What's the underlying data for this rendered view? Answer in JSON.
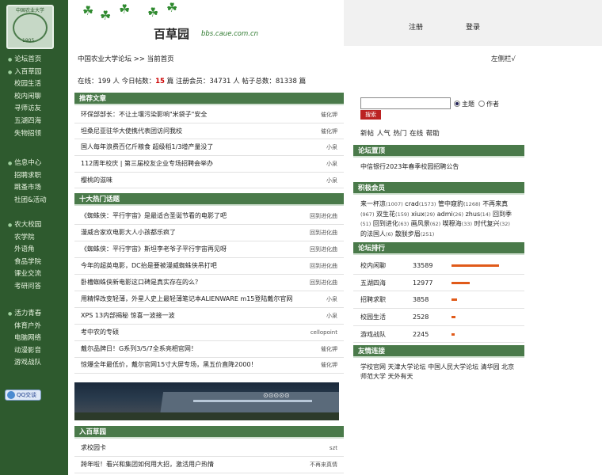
{
  "sidebar": {
    "logo": {
      "top_text": "中国农业大学",
      "year": "1905"
    },
    "sections": [
      {
        "items": [
          "论坛首页",
          "入百草园",
          "校园生活",
          "校内闲聊",
          "寻师访友",
          "五湖四海",
          "失物招领"
        ]
      },
      {
        "items": [
          "信息中心",
          "招聘求职",
          "跳蚤市场",
          "社团&活动"
        ]
      },
      {
        "items": [
          "农大校园",
          "农学院",
          "外语角",
          "食品学院",
          "课业交流",
          "考研问答"
        ]
      },
      {
        "items": [
          "活力青春",
          "体育户外",
          "电脑网络",
          "动漫影音",
          "游戏战队"
        ]
      }
    ],
    "qq_label": "QQ交谈"
  },
  "header": {
    "site_name": "百草园",
    "site_url": "bbs.caue.com.cn",
    "register": "注册",
    "login": "登录"
  },
  "breadcrumb": "中国农业大学论坛 >> 当前首页",
  "left_toggle": "左侧栏√",
  "stats": {
    "p1": "在线：199 人 今日帖数：",
    "today": "15",
    "p2": " 篇 注册会员：34731 人 帖子总数：81338 篇"
  },
  "recommend": {
    "title": "推荐文章",
    "rows": [
      {
        "t": "环保部部长：不让土壤污染影响\"米袋子\"安全",
        "a": "催化钾"
      },
      {
        "t": "坦桑尼亚驻华大使携代表团访问我校",
        "a": "催化钾"
      },
      {
        "t": "国人每年浪费百亿斤粮食 超级稻1/3增产量没了",
        "a": "小泉"
      },
      {
        "t": "112周年校庆 | 第三届校友企业专场招聘会举办",
        "a": "小泉"
      },
      {
        "t": "樱桃的滋味",
        "a": "小泉"
      }
    ]
  },
  "hot": {
    "title": "十大热门话题",
    "rows": [
      {
        "t": "《蜘蛛侠：平行宇宙》是最适合圣诞节看的电影了吧",
        "a": "回到进化曲"
      },
      {
        "t": "漫威合家欢电影大人小孩都乐疯了",
        "a": "回到进化曲"
      },
      {
        "t": "《蜘蛛侠：平行宇宙》斯坦李老爷子平行宇宙再见呀",
        "a": "回到进化曲"
      },
      {
        "t": "今年的超英电影，DC抬是要被漫威蜘蛛侠吊打吧",
        "a": "回到进化曲"
      },
      {
        "t": "卧槽蜘蛛侠新电影这口碑是真实存在的么？",
        "a": "回到进化曲"
      },
      {
        "t": "用精悍改变轻薄，外星人史上最轻薄笔记本ALIENWARE m15登陆戴尔官网",
        "a": "小泉"
      },
      {
        "t": "XPS 13内部揭秘 惊喜一波接一波",
        "a": "小泉"
      },
      {
        "t": "考中农的专硕",
        "a": "cellopoint"
      },
      {
        "t": "戴尔品牌日！G系列3/5/7全系亮相官网！",
        "a": "催化钾"
      },
      {
        "t": "惊爆全年最低价，戴尔官网15寸大屏专场，黑五价直降2000！",
        "a": "催化钾"
      }
    ]
  },
  "banner_image": {
    "text": "⊙⊙⊙⊙⊙"
  },
  "enter": {
    "title": "入百草园",
    "rows": [
      {
        "t": "求校园卡",
        "a": "szt"
      },
      {
        "t": "跨年啦！看兴和集团如何用大招，激活用户热情",
        "a": "不再来真情"
      }
    ]
  },
  "search": {
    "button": "搜索",
    "opt1": "主题",
    "opt2": "作者"
  },
  "quick_links": "新帖 人气 热门 在线 帮助",
  "pinned": {
    "title": "论坛置顶",
    "text": "中信银行2023年春季校园招聘公告"
  },
  "members": {
    "title": "积极会员",
    "list": [
      {
        "n": "来一杯凉",
        "c": "(1007)"
      },
      {
        "n": "crad",
        "c": "(1573)"
      },
      {
        "n": "管中窥豹",
        "c": "(1268)"
      },
      {
        "n": "不再来真",
        "c": "(967)"
      },
      {
        "n": "双生花",
        "c": "(159)"
      },
      {
        "n": "xiux",
        "c": "(29)"
      },
      {
        "n": "admi",
        "c": "(26)"
      },
      {
        "n": "zhus",
        "c": "(14)"
      },
      {
        "n": "回到季",
        "c": "(51)"
      },
      {
        "n": "回到进化",
        "c": "(63)"
      },
      {
        "n": "画风景",
        "c": "(62)"
      },
      {
        "n": "喫穆海",
        "c": "(33)"
      },
      {
        "n": "时代复兴",
        "c": "(32)"
      },
      {
        "n": "的法国人",
        "c": "(6)"
      },
      {
        "n": "散朕步眉",
        "c": "(251)"
      }
    ]
  },
  "ranking": {
    "title": "论坛排行",
    "rows": [
      {
        "n": "校内闲聊",
        "v": "33589",
        "f": 1.0
      },
      {
        "n": "五湖四海",
        "v": "12977",
        "f": 0.39
      },
      {
        "n": "招聘求职",
        "v": "3858",
        "f": 0.12
      },
      {
        "n": "校园生活",
        "v": "2528",
        "f": 0.08
      },
      {
        "n": "游戏战队",
        "v": "2245",
        "f": 0.07
      }
    ]
  },
  "friends": {
    "title": "友情连接",
    "text": "学校官网 天津大学论坛 中国人民大学论坛 清华园 北京师范大学 天外有天"
  }
}
